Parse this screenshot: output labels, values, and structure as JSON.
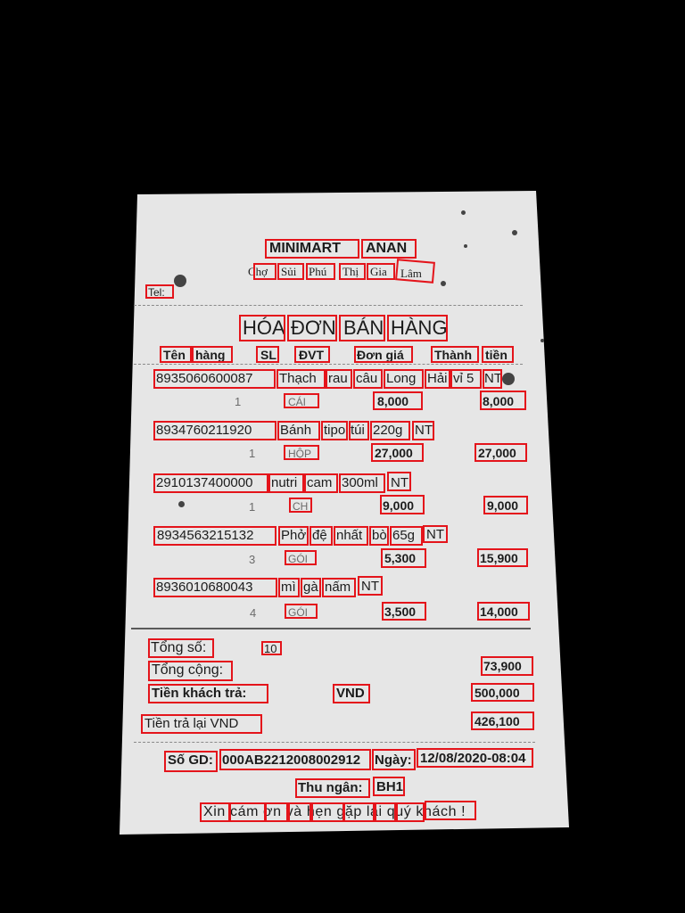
{
  "store": {
    "name_a": "MINIMART",
    "name_b": "ANAN",
    "address": [
      "Chợ",
      "Sủi",
      "Phú",
      "Thị",
      "Gia",
      "Lâm"
    ],
    "tel_label": "Tel:"
  },
  "receipt_title": [
    "HÓA",
    "ĐƠN",
    "BÁN",
    "HÀNG"
  ],
  "columns": {
    "ten": "Tên",
    "hang": "hàng",
    "sl": "SL",
    "dvt": "ĐVT",
    "don_gia": "Đơn giá",
    "thanh": "Thành",
    "tien": "tiền"
  },
  "items": [
    {
      "line1": [
        "8935060600087",
        "Thạch",
        "rau",
        "câu",
        "Long",
        "Hải",
        "vỉ 5",
        "NT"
      ],
      "qty": "1",
      "unit": "CÁI",
      "price": "8,000",
      "total": "8,000"
    },
    {
      "line1": [
        "8934760211920",
        "Bánh",
        "tipo",
        "túi",
        "220g",
        "NT"
      ],
      "qty": "1",
      "unit": "HỘP",
      "price": "27,000",
      "total": "27,000"
    },
    {
      "line1": [
        "2910137400000",
        "nutri",
        "cam",
        "300ml",
        "NT"
      ],
      "qty": "1",
      "unit": "CH",
      "price": "9,000",
      "total": "9,000"
    },
    {
      "line1": [
        "8934563215132",
        "Phở",
        "đệ",
        "nhất",
        "bò",
        "65g",
        "NT"
      ],
      "qty": "3",
      "unit": "GÓI",
      "price": "5,300",
      "total": "15,900"
    },
    {
      "line1": [
        "8936010680043",
        "mì",
        "gà",
        "nấm",
        "NT"
      ],
      "qty": "4",
      "unit": "GÓI",
      "price": "3,500",
      "total": "14,000"
    }
  ],
  "summary": {
    "tong_so_label": "Tổng số:",
    "tong_so_value": "10",
    "tong_cong_label": "Tổng cộng:",
    "tong_cong_value": "73,900",
    "tien_khach_label": "Tiền khách trả:",
    "currency": "VND",
    "tien_khach_value": "500,000",
    "tien_tra_lai_label": "Tiền trả lại VND",
    "tien_tra_lai_value": "426,100"
  },
  "footer": {
    "so_gd_label": "Số GD:",
    "so_gd_value": "000AB2212008002912",
    "ngay_label": "Ngày:",
    "ngay_value": "12/08/2020-08:04",
    "thu_ngan_label": "Thu ngân:",
    "thu_ngan_value": "BH1",
    "thanks": "Xin cám ơn và hẹn gặp lại quý khách !"
  },
  "colors": {
    "paper": "#e8e8e8",
    "box_outline": "#e4141b",
    "background": "#000000"
  }
}
